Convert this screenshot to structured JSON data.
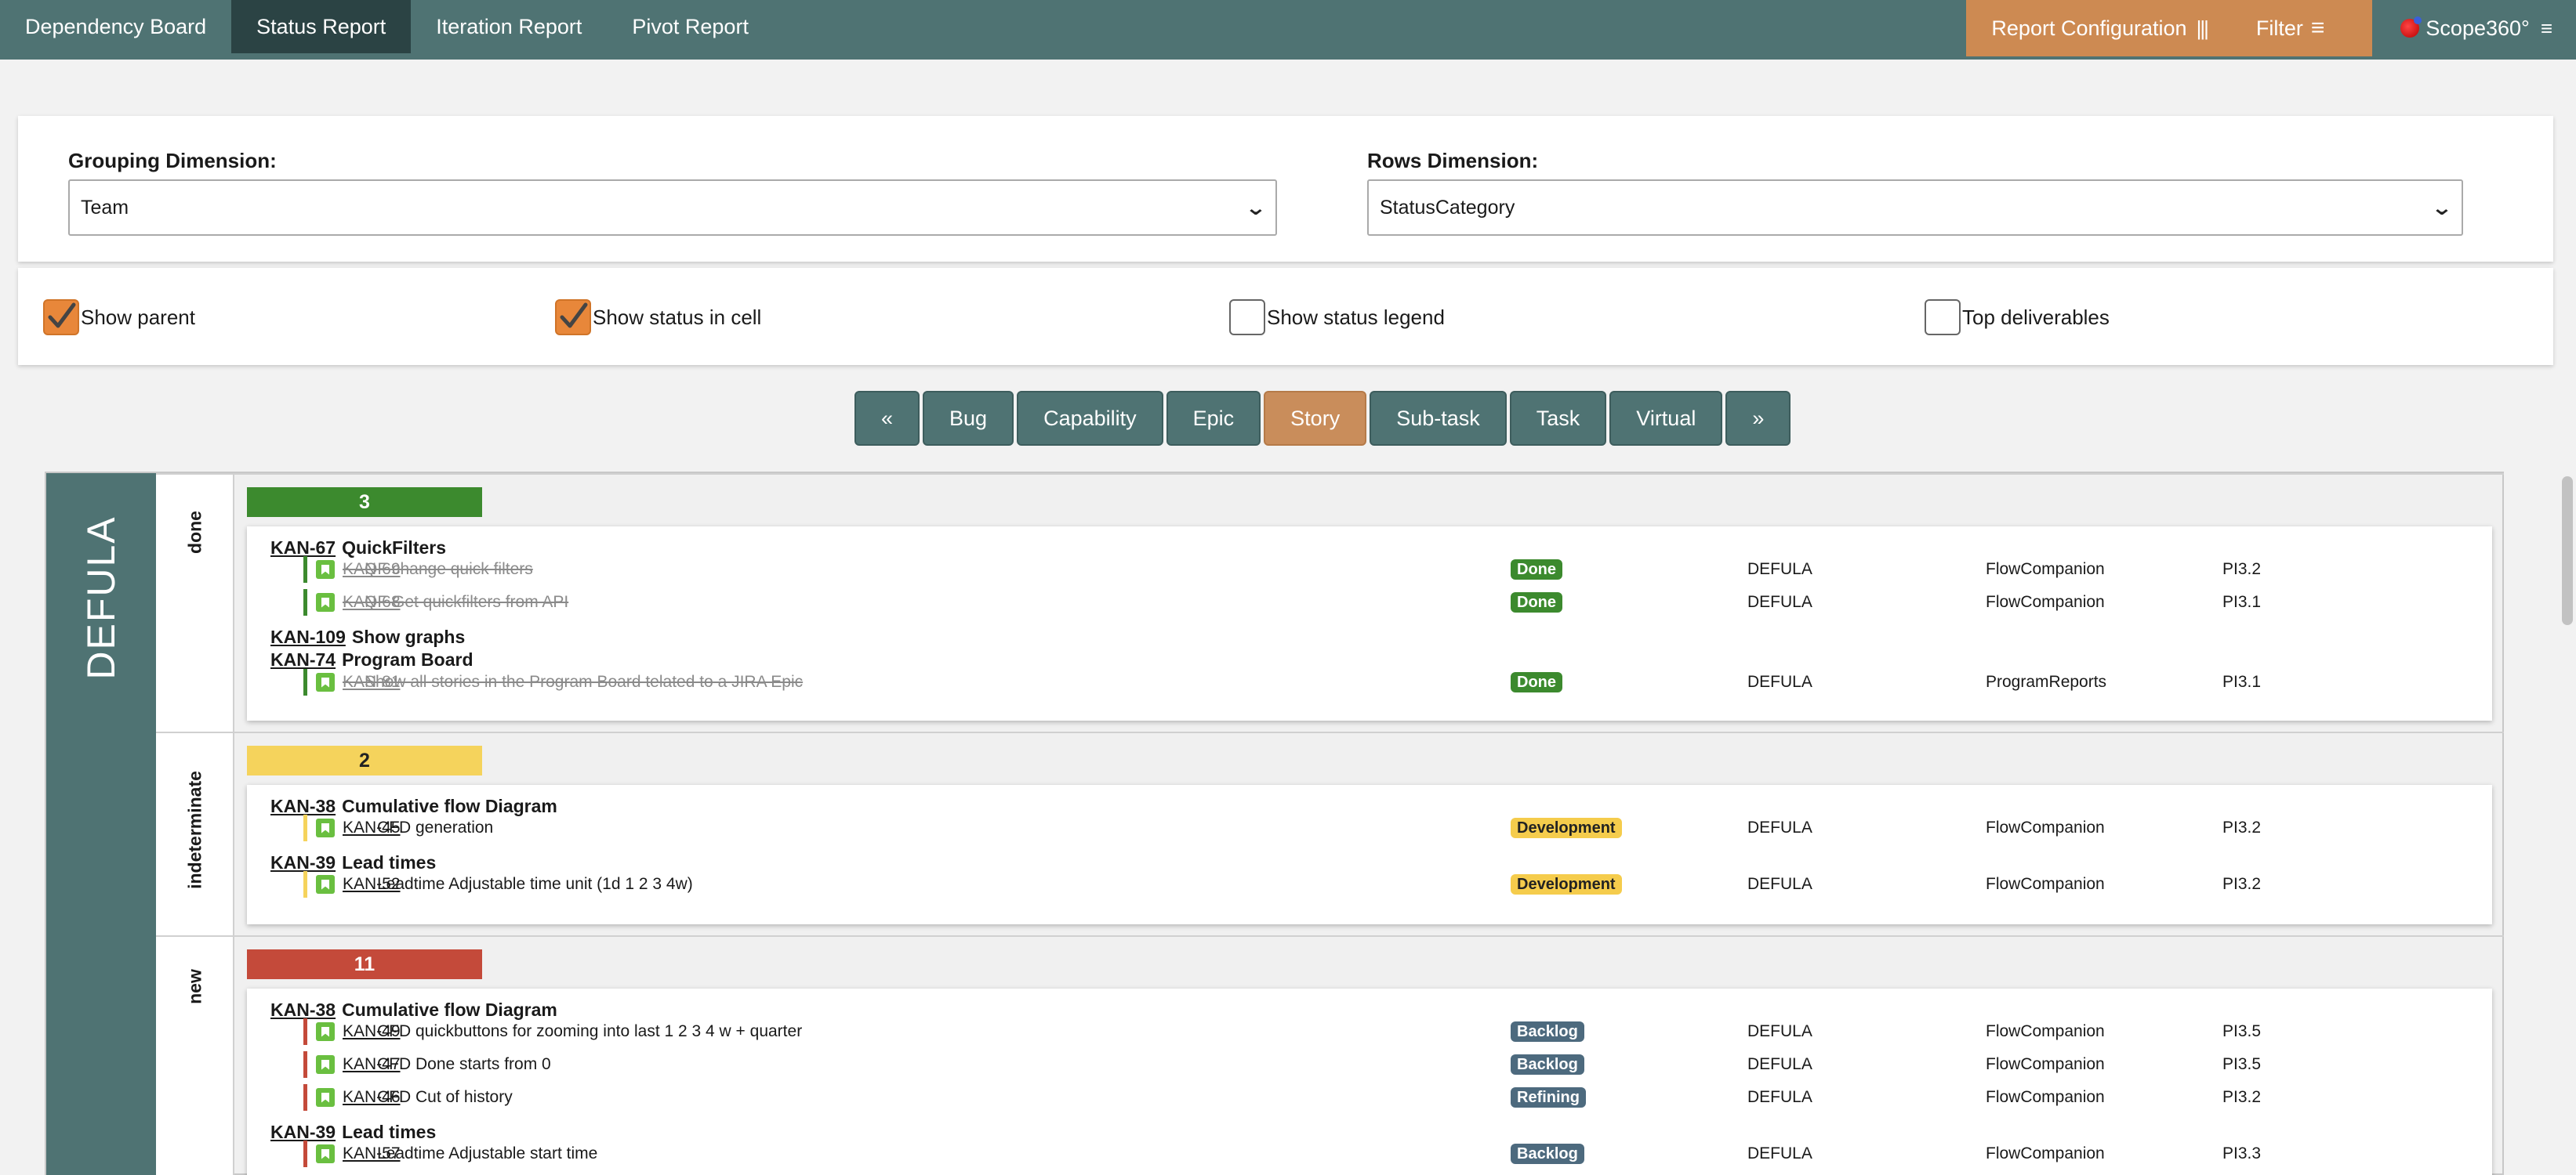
{
  "nav": {
    "tabs": [
      "Dependency Board",
      "Status Report",
      "Iteration Report",
      "Pivot Report"
    ],
    "active_tab": "Status Report",
    "report_configuration": "Report Configuration",
    "filter": "Filter",
    "scope": "Scope360°"
  },
  "config": {
    "grouping_label": "Grouping Dimension:",
    "grouping_value": "Team",
    "rows_label": "Rows Dimension:",
    "rows_value": "StatusCategory"
  },
  "options": {
    "show_parent": {
      "label": "Show parent",
      "checked": true
    },
    "show_status_in_cell": {
      "label": "Show status in cell",
      "checked": true
    },
    "show_status_legend": {
      "label": "Show status legend",
      "checked": false
    },
    "top_deliverables": {
      "label": "Top deliverables",
      "checked": false
    }
  },
  "issue_types": {
    "prev": "«",
    "next": "»",
    "items": [
      "Bug",
      "Capability",
      "Epic",
      "Story",
      "Sub-task",
      "Task",
      "Virtual"
    ],
    "active": "Story"
  },
  "board": {
    "team": "DEFULA",
    "sections": [
      {
        "label": "done",
        "count": "3",
        "color": "#3c8a2e",
        "groups": [
          {
            "key": "KAN-67",
            "title": "QuickFilters",
            "children": [
              {
                "key": "KAN-69",
                "summary": " QF change quick filters",
                "status": "Done",
                "team": "DEFULA",
                "project": "FlowCompanion",
                "pi": "PI3.2"
              },
              {
                "key": "KAN-68",
                "summary": " QF Get quickfilters from API",
                "status": "Done",
                "team": "DEFULA",
                "project": "FlowCompanion",
                "pi": "PI3.1"
              }
            ]
          },
          {
            "key": "KAN-109",
            "title": "Show graphs",
            "children": []
          },
          {
            "key": "KAN-74",
            "title": "Program Board",
            "children": [
              {
                "key": "KAN-81",
                "summary": " Show all stories in the Program Board telated to a JIRA Epic",
                "status": "Done",
                "team": "DEFULA",
                "project": "ProgramReports",
                "pi": "PI3.1"
              }
            ]
          }
        ]
      },
      {
        "label": "indeterminate",
        "count": "2",
        "color": "#f5d35c",
        "groups": [
          {
            "key": "KAN-38",
            "title": "Cumulative flow Diagram",
            "children": [
              {
                "key": "KAN-45",
                "summary": "CFD generation",
                "status": "Development",
                "team": "DEFULA",
                "project": "FlowCompanion",
                "pi": "PI3.2"
              }
            ]
          },
          {
            "key": "KAN-39",
            "title": "Lead times",
            "children": [
              {
                "key": "KAN-52",
                "summary": "Leadtime Adjustable time unit (1d 1 2 3 4w)",
                "status": "Development",
                "team": "DEFULA",
                "project": "FlowCompanion",
                "pi": "PI3.2"
              }
            ]
          }
        ]
      },
      {
        "label": "new",
        "count": "11",
        "color": "#c44a3a",
        "groups": [
          {
            "key": "KAN-38",
            "title": "Cumulative flow Diagram",
            "children": [
              {
                "key": "KAN-49",
                "summary": "CFD quickbuttons for zooming into last 1 2 3 4 w + quarter",
                "status": "Backlog",
                "team": "DEFULA",
                "project": "FlowCompanion",
                "pi": "PI3.5"
              },
              {
                "key": "KAN-47",
                "summary": "CFD Done starts from 0",
                "status": "Backlog",
                "team": "DEFULA",
                "project": "FlowCompanion",
                "pi": "PI3.5"
              },
              {
                "key": "KAN-46",
                "summary": "CFD Cut of history",
                "status": "Refining",
                "team": "DEFULA",
                "project": "FlowCompanion",
                "pi": "PI3.2"
              }
            ]
          },
          {
            "key": "KAN-39",
            "title": "Lead times",
            "children": [
              {
                "key": "KAN-57",
                "summary": "Leadtime Adjustable start time",
                "status": "Backlog",
                "team": "DEFULA",
                "project": "FlowCompanion",
                "pi": "PI3.3"
              }
            ]
          }
        ]
      }
    ]
  }
}
